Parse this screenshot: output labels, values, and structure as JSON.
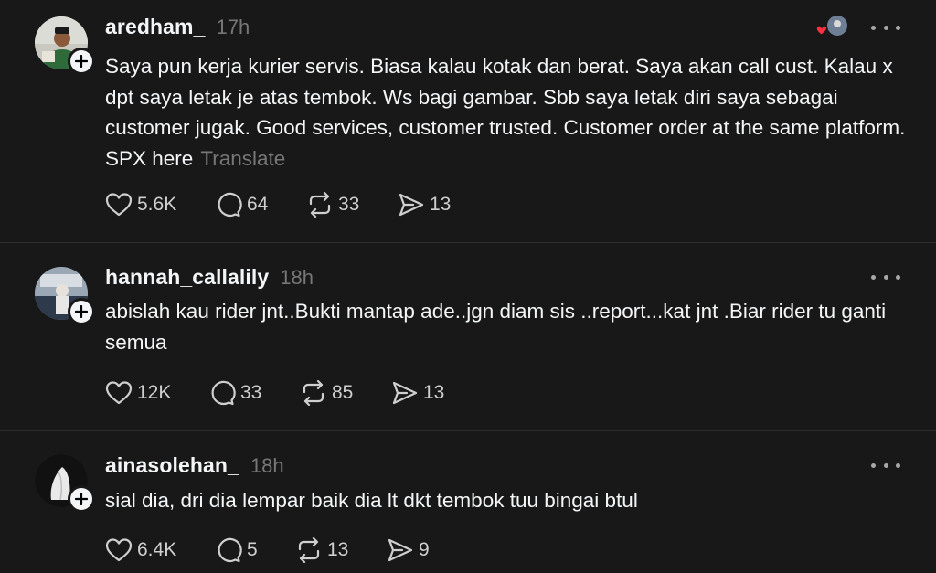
{
  "posts": [
    {
      "username": "aredham_",
      "time": "17h",
      "text": "Saya pun kerja kurier servis. Biasa kalau kotak dan berat. Saya akan call cust. Kalau x dpt saya letak je atas tembok. Ws bagi gambar. Sbb saya letak diri saya sebagai customer jugak. Good services, customer trusted. Customer order at the same platform. SPX here",
      "translate": "Translate",
      "likes": "5.6K",
      "replies": "64",
      "reposts": "33",
      "shares": "13"
    },
    {
      "username": "hannah_callalily",
      "time": "18h",
      "text": "abislah kau rider jnt..Bukti mantap ade..jgn diam sis ..report...kat jnt .Biar rider tu ganti semua",
      "likes": "12K",
      "replies": "33",
      "reposts": "85",
      "shares": "13"
    },
    {
      "username": "ainasolehan_",
      "time": "18h",
      "text": "sial dia, dri dia lempar baik dia lt dkt tembok tuu bingai btul",
      "likes": "6.4K",
      "replies": "5",
      "reposts": "13",
      "shares": "9"
    }
  ],
  "colors": {
    "background": "#181818",
    "text": "#f3f5f7",
    "muted": "#777777",
    "divider": "#2e2e2e",
    "heart_accent": "#ff3040"
  },
  "icons": [
    "heart-icon",
    "reply-icon",
    "repost-icon",
    "share-icon",
    "more-icon",
    "plus-icon"
  ]
}
